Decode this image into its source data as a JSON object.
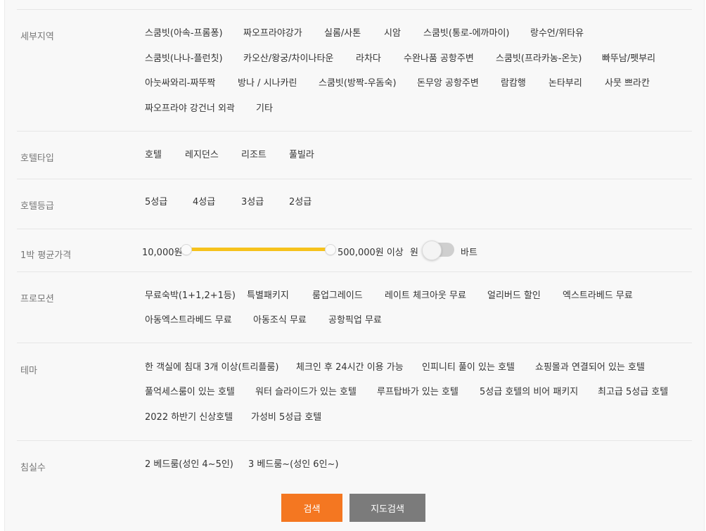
{
  "sections": {
    "area": {
      "label": "세부지역",
      "options": [
        "스쿰빗(아속-프롬퐁)",
        "짜오프라야강가",
        "실롬/사톤",
        "시암",
        "스쿰빗(통로-에까마이)",
        "랑수언/위타유",
        "스쿰빗(나나-플런칫)",
        "카오산/왕궁/차이나타운",
        "라차다",
        "수완나품 공항주변",
        "스쿰빗(프라카농-온눗)",
        "빠뚜남/펫부리",
        "아눗싸와리-짜뚜짝",
        "방나 / 시나카린",
        "스쿰빗(방짝-우돔숙)",
        "돈무앙 공항주변",
        "람캄행",
        "논타부리",
        "사뭇 쁘라칸",
        "짜오프라야 강건너 외곽",
        "기타"
      ]
    },
    "hotel_type": {
      "label": "호텔타입",
      "options": [
        "호텔",
        "레지던스",
        "리조트",
        "풀빌라"
      ]
    },
    "hotel_grade": {
      "label": "호텔등급",
      "options": [
        "5성급",
        "4성급",
        "3성급",
        "2성급"
      ]
    },
    "price": {
      "label": "1박 평균가격",
      "min_text": "10,000원",
      "max_text": "500,000원 이상",
      "currency_won": "원",
      "currency_baht": "바트",
      "range_fraction": [
        0,
        1
      ]
    },
    "promotion": {
      "label": "프로모션",
      "options": [
        "무료숙박(1+1,2+1등)",
        "특별패키지",
        "룸업그레이드",
        "레이트 체크아웃 무료",
        "얼리버드 할인",
        "엑스트라베드 무료",
        "아동엑스트라베드 무료",
        "아동조식 무료",
        "공항픽업 무료"
      ]
    },
    "theme": {
      "label": "테마",
      "options": [
        "한 객실에 침대 3개 이상(트리플룸)",
        "체크인 후 24시간 이용 가능",
        "인피니티 풀이 있는 호텔",
        "쇼핑몰과 연결되어 있는 호텔",
        "풀억세스룸이 있는 호텔",
        "워터 슬라이드가 있는 호텔",
        "루프탑바가 있는 호텔",
        "5성급 호텔의 비어 패키지",
        "최고급 5성급 호텔",
        "2022 하반기 신상호텔",
        "가성비 5성급 호텔"
      ]
    },
    "bedrooms": {
      "label": "침실수",
      "options": [
        "2 베드룸(성인 4~5인)",
        "3 베드룸~(성인 6인~)"
      ]
    }
  },
  "buttons": {
    "search": "검색",
    "map_search": "지도검색"
  },
  "colors": {
    "accent": "#f47721",
    "slider_fill": "#f6c21c",
    "map_button": "#7b7b7b"
  }
}
